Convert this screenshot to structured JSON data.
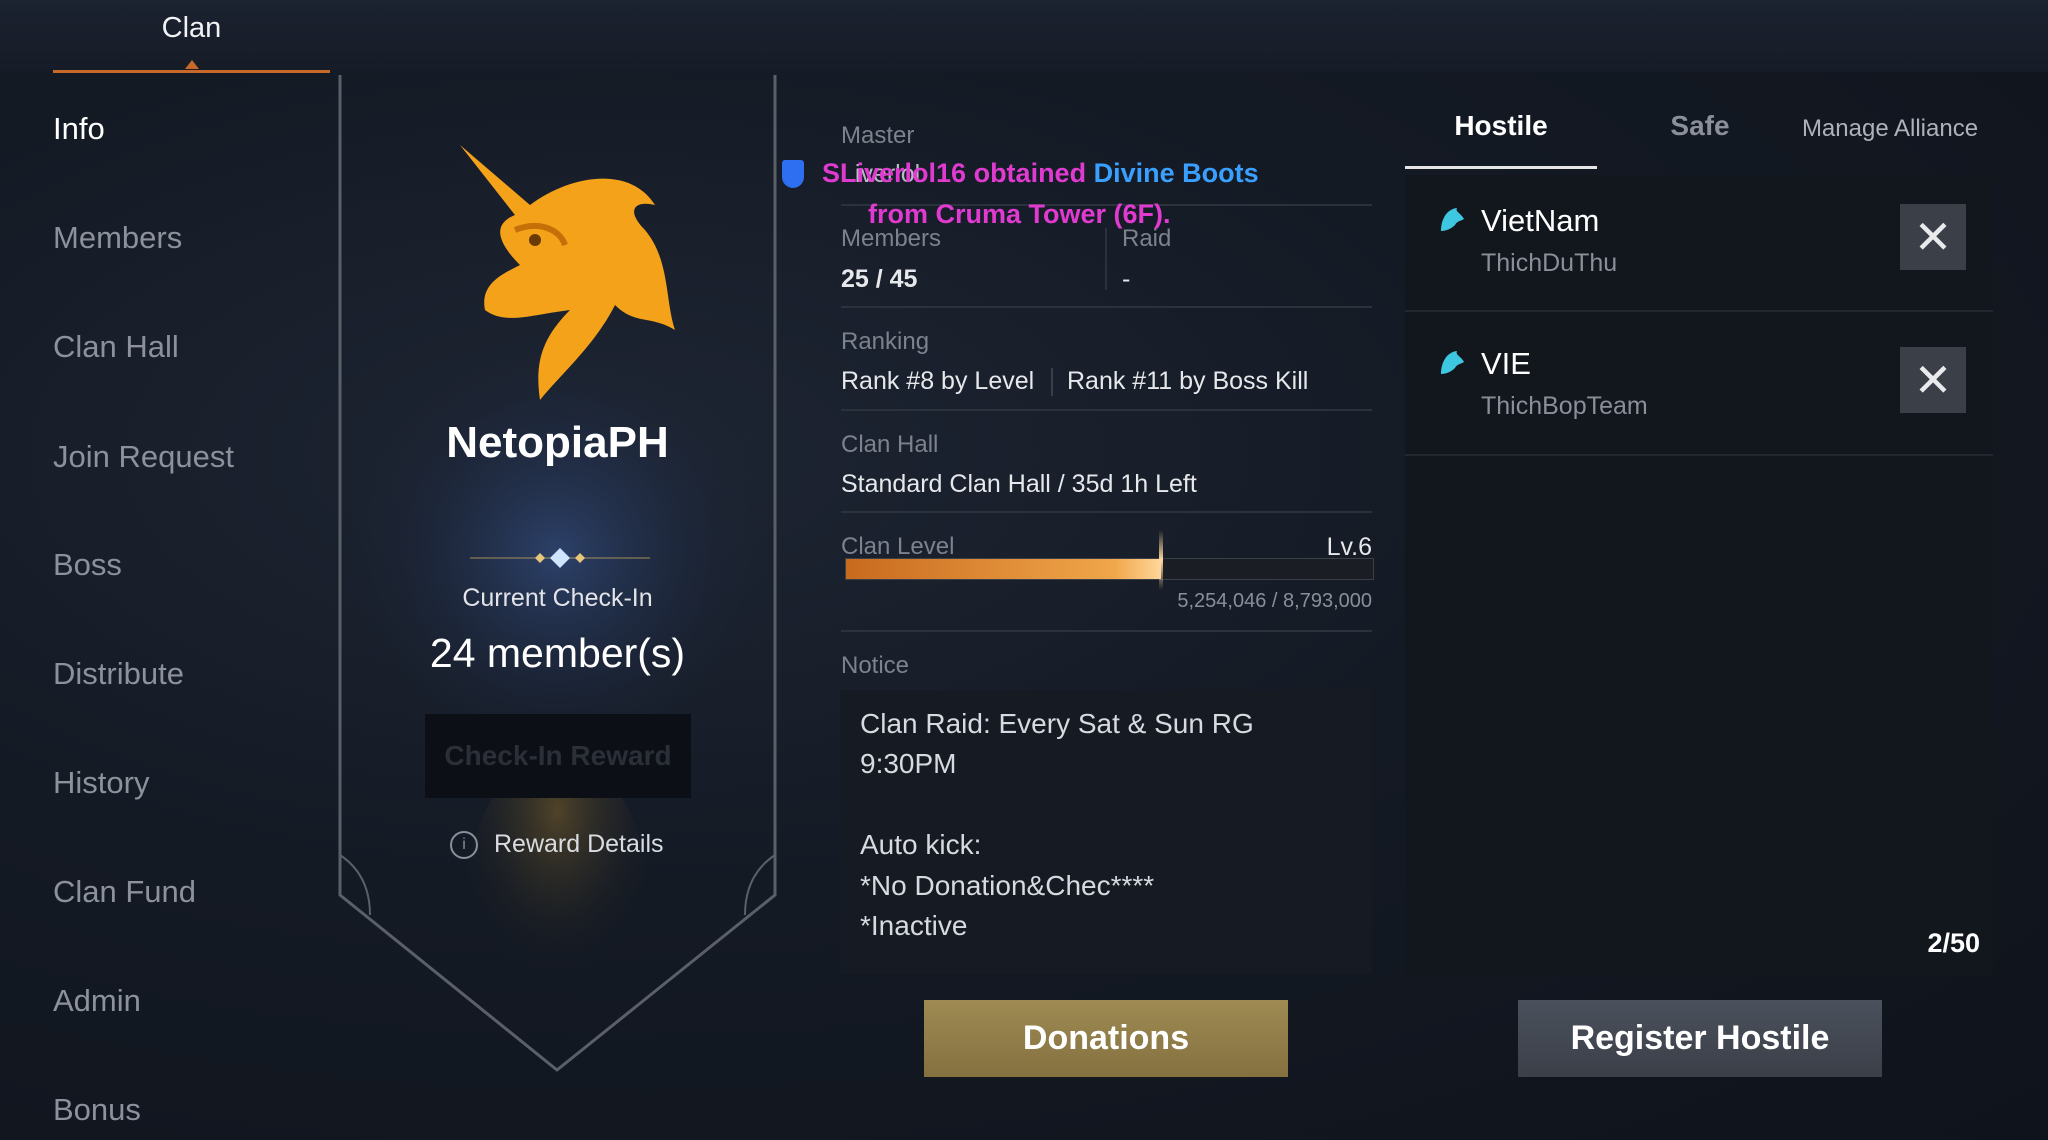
{
  "header": {
    "active_tab": "Clan"
  },
  "sidebar": {
    "items": [
      {
        "label": "Info",
        "active": true
      },
      {
        "label": "Members"
      },
      {
        "label": "Clan Hall"
      },
      {
        "label": "Join Request"
      },
      {
        "label": "Boss"
      },
      {
        "label": "Distribute"
      },
      {
        "label": "History"
      },
      {
        "label": "Clan Fund"
      },
      {
        "label": "Admin"
      },
      {
        "label": "Bonus"
      }
    ]
  },
  "emblem_panel": {
    "clan_name": "NetopiaPH",
    "checkin_label": "Current Check-In",
    "checkin_count": "24 member(s)",
    "checkin_reward_button": "Check-In Reward",
    "reward_details": "Reward Details"
  },
  "system_message": {
    "line1_prefix": "SLiverlol16 obtained ",
    "item": "Divine Boots",
    "line2": "from Cruma Tower (6F)."
  },
  "info": {
    "master_label": "Master",
    "master_value": "Liverlol",
    "members_label": "Members",
    "members_value": "25 / 45",
    "raid_label": "Raid",
    "raid_value": "-",
    "ranking_label": "Ranking",
    "rank_level": "Rank #8 by Level",
    "rank_boss": "Rank #11 by Boss Kill",
    "clan_hall_label": "Clan Hall",
    "clan_hall_value": "Standard Clan Hall / 35d 1h Left",
    "clan_level_label": "Clan Level",
    "clan_level_value": "Lv.6",
    "xp_text": "5,254,046 / 8,793,000",
    "xp_fraction": 0.5975,
    "notice_label": "Notice",
    "notice_lines": [
      "Clan Raid: Every Sat & Sun RG",
      "9:30PM",
      "",
      "Auto kick:",
      "*No Donation&Chec****",
      "*Inactive"
    ]
  },
  "alliance": {
    "tabs": [
      "Hostile",
      "Safe",
      "Manage Alliance"
    ],
    "hostiles": [
      {
        "name": "VietNam",
        "sub": "ThichDuThu"
      },
      {
        "name": "VIE",
        "sub": "ThichBopTeam"
      }
    ],
    "count": "2/50"
  },
  "buttons": {
    "donations": "Donations",
    "register_hostile": "Register Hostile"
  },
  "colors": {
    "accent_orange": "#c8692a",
    "message_magenta": "#e03ad0",
    "item_blue": "#3aa0ff",
    "emblem_gold": "#f5a21b",
    "hostile_icon_cyan": "#3ec7e0"
  }
}
